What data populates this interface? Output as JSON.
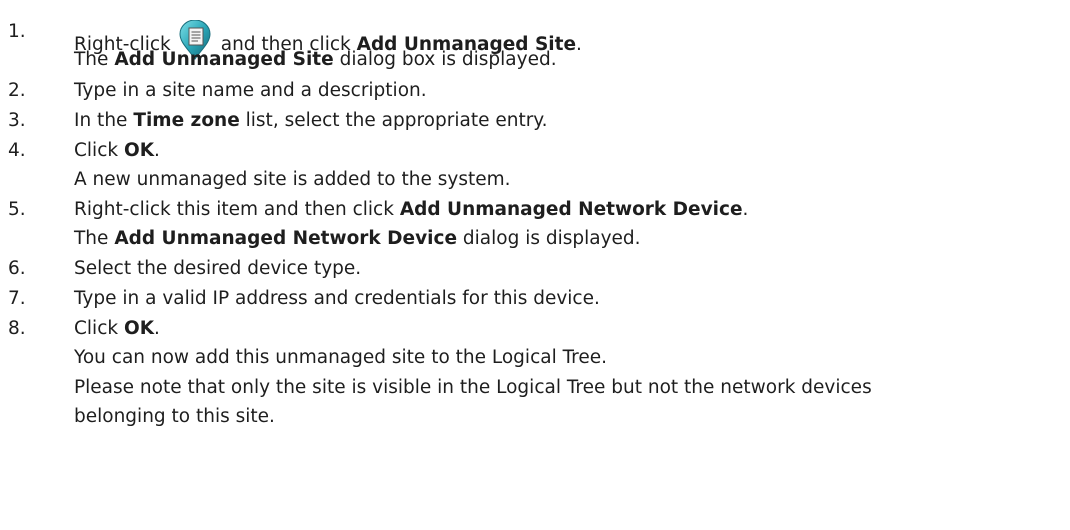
{
  "steps": [
    {
      "number": "1.",
      "line1": {
        "before": "Right-click",
        "middle": "and then click",
        "bold": "Add Unmanaged Site",
        "after": "."
      },
      "icon": "unmanaged-site-icon",
      "line2": {
        "before": "The",
        "bold": "Add Unmanaged Site",
        "after": "dialog box is displayed."
      }
    },
    {
      "number": "2.",
      "text": "Type in a site name and a description."
    },
    {
      "number": "3.",
      "line1": {
        "before": "In the",
        "bold": "Time zone",
        "after": "list, select the appropriate entry."
      }
    },
    {
      "number": "4.",
      "line1": {
        "before": "Click",
        "bold": "OK",
        "after": "."
      },
      "line2": "A new unmanaged site is added to the system."
    },
    {
      "number": "5.",
      "line1": {
        "before": "Right-click this item and then click",
        "bold": "Add Unmanaged Network Device",
        "after": "."
      },
      "line2": {
        "before": "The",
        "bold": "Add Unmanaged Network Device",
        "after": "dialog is displayed."
      }
    },
    {
      "number": "6.",
      "text": "Select the desired device type."
    },
    {
      "number": "7.",
      "text": "Type in a valid IP address and credentials for this device."
    },
    {
      "number": "8.",
      "line1": {
        "before": "Click",
        "bold": "OK",
        "after": "."
      },
      "line2": "You can now add this unmanaged site to the Logical Tree.",
      "line3": "Please note that only the site is visible in the Logical Tree but not the network devices",
      "line4": "belonging to this site."
    }
  ],
  "colors": {
    "text": "#1e1e1e",
    "icon_teal": "#2aa7b8",
    "icon_dark": "#1b6f7d"
  }
}
